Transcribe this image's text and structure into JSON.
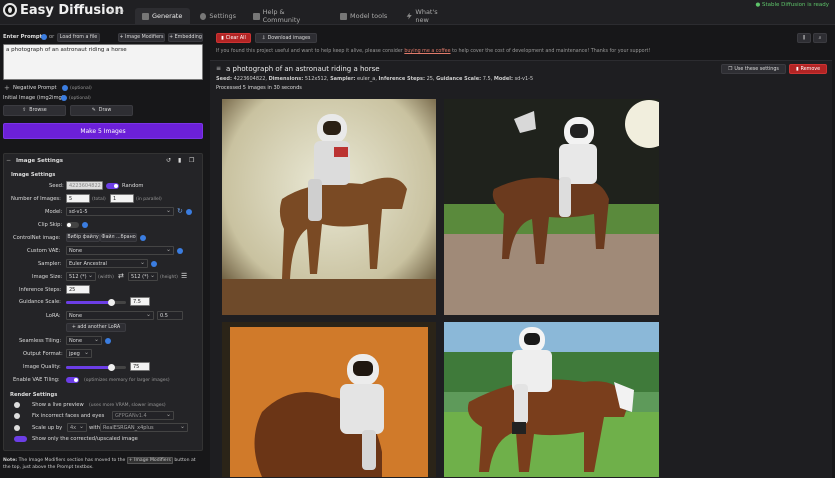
{
  "app": {
    "title": "Easy Diffusion",
    "version": "v3.0.9",
    "status": "Stable Diffusion is ready"
  },
  "tabs": [
    {
      "label": "Generate",
      "icon": "image-icon"
    },
    {
      "label": "Settings",
      "icon": "gear-icon"
    },
    {
      "label": "Help & Community",
      "icon": "chat-icon"
    },
    {
      "label": "Model tools",
      "icon": "toolbox-icon"
    },
    {
      "label": "What's new",
      "icon": "bolt-icon"
    }
  ],
  "prompt": {
    "label": "Enter Prompt",
    "or": "or",
    "load_file": "Load from a file",
    "image_modifiers": "+ Image Modifiers",
    "embedding": "+ Embedding",
    "value": "a photograph of an astronaut riding a horse",
    "negative_label": "Negative Prompt",
    "negative_optional": "(optional)",
    "initial_image_label": "Initial Image (img2img)",
    "initial_image_optional": "(optional)",
    "browse": "Browse",
    "draw": "Draw",
    "make_button": "Make 5 Images"
  },
  "settings": {
    "panel_title": "Image Settings",
    "section_title": "Image Settings",
    "seed_label": "Seed:",
    "seed_value": "4223604822",
    "random_label": "Random",
    "num_images_label": "Number of Images:",
    "num_total": "5",
    "total_label": "(total)",
    "num_parallel": "1",
    "parallel_label": "(in parallel)",
    "model_label": "Model:",
    "model_value": "sd-v1-5",
    "clip_skip_label": "Clip Skip:",
    "controlnet_label": "ControlNet image:",
    "controlnet_btn1": "Вибір файлу",
    "controlnet_btn2": "Файл ...брано",
    "vae_label": "Custom VAE:",
    "vae_value": "None",
    "sampler_label": "Sampler:",
    "sampler_value": "Euler Ancestral",
    "size_label": "Image Size:",
    "width_value": "512 (*)",
    "width_label": "(width)",
    "height_value": "512 (*)",
    "height_label": "(height)",
    "steps_label": "Inference Steps:",
    "steps_value": "25",
    "guidance_label": "Guidance Scale:",
    "guidance_value": "7.5",
    "guidance_fraction": 0.75,
    "lora_label": "LoRA:",
    "lora_value": "None",
    "lora_strength": "0.5",
    "add_lora": "+ add another LoRA",
    "seamless_label": "Seamless Tiling:",
    "seamless_value": "None",
    "format_label": "Output Format:",
    "format_value": "jpeg",
    "quality_label": "Image Quality:",
    "quality_value": "75",
    "quality_fraction": 0.75,
    "vae_tiling_label": "Enable VAE Tiling:",
    "vae_tiling_note": "(optimizes memory for larger images)",
    "render_title": "Render Settings",
    "live_preview": "Show a live preview",
    "live_preview_note": "(uses more VRAM, slower images)",
    "fix_faces": "Fix incorrect faces and eyes",
    "fix_faces_model": "GFPGANv1.4",
    "scale_up": "Scale up by",
    "scale_factor": "4x",
    "with_label": "with",
    "upscaler": "RealESRGAN_x4plus",
    "only_corrected": "Show only the corrected/upscaled image"
  },
  "note": {
    "prefix": "Note:",
    "text1": "The Image Modifiers section has moved to the",
    "button": "+ Image Modifiers",
    "text2": "button at the top, just above the Prompt textbox."
  },
  "output": {
    "clear_all": "Clear All",
    "download": "Download images",
    "support_text1": "If you found this project useful and want to help keep it alive, please consider",
    "support_link": "buying me a coffee",
    "support_text2": "to help cover the cost of development and maintenance! Thanks for your support!",
    "task_title": "a photograph of an astronaut riding a horse",
    "seed_label": "Seed:",
    "seed_value": "4223604822,",
    "dim_label": "Dimensions:",
    "dim_value": "512x512,",
    "sampler_label": "Sampler:",
    "sampler_value": "euler_a,",
    "steps_label": "Inference Steps:",
    "steps_value": "25,",
    "guidance_label": "Guidance Scale:",
    "guidance_value": "7.5,",
    "model_label": "Model:",
    "model_value": "sd-v1-5",
    "processed": "Processed 5 images in 30 seconds",
    "use_settings": "Use these settings",
    "remove": "Remove"
  },
  "colors": {
    "accent": "#6c3ee6",
    "danger": "#b32424",
    "status": "#5ec46a"
  }
}
